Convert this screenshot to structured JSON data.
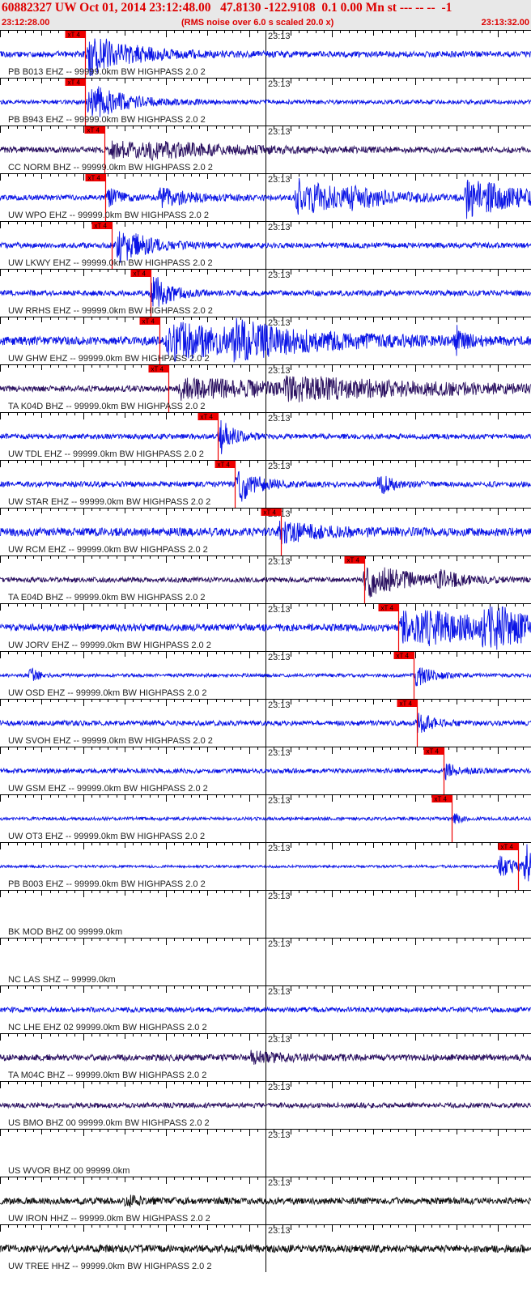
{
  "header": {
    "title": "60882327 UW Oct 01, 2014 23:12:48.00   47.8130 -122.9108  0.1 0.00 Mn st --- -- --  -1",
    "start_time": "23:12:28.00",
    "rms_note": "(RMS noise over 6.0 s scaled 20.0 x)",
    "end_time": "23:13:32.00"
  },
  "colors": {
    "blue": "#0a14e6",
    "dark": "#2a1060",
    "black": "#111111",
    "pick": "#ee0000",
    "axis": "#000000"
  },
  "chart_data": {
    "type": "line",
    "title": "60882327 UW Oct 01, 2014 23:12:48.00   47.8130 -122.9108  0.1 0.00 Mn st --- -- --  -1",
    "x_range": [
      "23:12:28.00",
      "23:13:32.00"
    ],
    "x_tick_label": "23:13",
    "traces": [
      {
        "label": "PB B013 EHZ -- 99999.0km BW  HIGHPASS  2.0  2",
        "color": "blue",
        "noise": 0.14,
        "pick": {
          "label": "xT 4",
          "t": 10.2
        },
        "bursts": [
          {
            "t": 10.5,
            "amp": 1.0,
            "dur": 5
          }
        ]
      },
      {
        "label": "PB B943 EHZ -- 99999.0km BW  HIGHPASS  2.0  2",
        "color": "blue",
        "noise": 0.1,
        "pick": {
          "label": "xT 4",
          "t": 10.2
        },
        "bursts": [
          {
            "t": 10.5,
            "amp": 0.95,
            "dur": 4
          }
        ]
      },
      {
        "label": "CC NORM BHZ -- 99999.0km BW  HIGHPASS  2.0  2",
        "color": "dark",
        "noise": 0.14,
        "pick": {
          "label": "xT 4",
          "t": 12.6
        },
        "bursts": [
          {
            "t": 13.2,
            "amp": 0.35,
            "dur": 8
          },
          {
            "t": 18,
            "amp": 0.2,
            "dur": 10
          }
        ]
      },
      {
        "label": "UW WPO EHZ -- 99999.0km BW  HIGHPASS  2.0  2",
        "color": "blue",
        "noise": 0.12,
        "pick": {
          "label": "xT 4",
          "t": 12.7
        },
        "bursts": [
          {
            "t": 12.8,
            "amp": 0.5,
            "dur": 1.5
          },
          {
            "t": 19,
            "amp": 0.45,
            "dur": 4
          },
          {
            "t": 35.5,
            "amp": 0.9,
            "dur": 7
          },
          {
            "t": 42,
            "amp": 0.3,
            "dur": 3
          },
          {
            "t": 56,
            "amp": 1.0,
            "dur": 6
          }
        ]
      },
      {
        "label": "UW LKWY EHZ -- 99999.0km BW  HIGHPASS  2.0  2",
        "color": "blue",
        "noise": 0.13,
        "pick": {
          "label": "xT 4",
          "t": 13.5
        },
        "bursts": [
          {
            "t": 14,
            "amp": 1.0,
            "dur": 3
          }
        ]
      },
      {
        "label": "UW RRHS EHZ -- 99999.0km BW  HIGHPASS  2.0  2",
        "color": "blue",
        "noise": 0.13,
        "pick": {
          "label": "xT 4",
          "t": 18.1
        },
        "bursts": [
          {
            "t": 18.2,
            "amp": 1.0,
            "dur": 2
          }
        ]
      },
      {
        "label": "UW GHW EHZ -- 99999.0km BW  HIGHPASS  2.0  2",
        "color": "blue",
        "noise": 0.2,
        "pick": {
          "label": "xT 4",
          "t": 19.2
        },
        "bursts": [
          {
            "t": 20,
            "amp": 0.85,
            "dur": 12
          },
          {
            "t": 28,
            "amp": 0.5,
            "dur": 8
          },
          {
            "t": 54.8,
            "amp": 0.6,
            "dur": 1
          },
          {
            "t": 65.5,
            "amp": 0.9,
            "dur": 1
          }
        ]
      },
      {
        "label": "TA K04D BHZ -- 99999.0km BW  HIGHPASS  2.0  2",
        "color": "dark",
        "noise": 0.14,
        "pick": {
          "label": "xT 4",
          "t": 20.3
        },
        "bursts": [
          {
            "t": 21.5,
            "amp": 0.45,
            "dur": 18
          },
          {
            "t": 34,
            "amp": 0.35,
            "dur": 20
          }
        ]
      },
      {
        "label": "UW TDL EHZ -- 99999.0km BW  HIGHPASS  2.0  2",
        "color": "blue",
        "noise": 0.12,
        "pick": {
          "label": "xT 4",
          "t": 26.2
        },
        "bursts": [
          {
            "t": 26.3,
            "amp": 1.0,
            "dur": 1.5
          }
        ]
      },
      {
        "label": "UW STAR EHZ -- 99999.0km BW  HIGHPASS  2.0  2",
        "color": "blue",
        "noise": 0.13,
        "pick": {
          "label": "xT 4",
          "t": 28.3
        },
        "bursts": [
          {
            "t": 28.5,
            "amp": 1.0,
            "dur": 2
          },
          {
            "t": 45.5,
            "amp": 0.55,
            "dur": 1.5
          }
        ]
      },
      {
        "label": "UW RCM EHZ -- 99999.0km BW  HIGHPASS  2.0  2",
        "color": "blue",
        "noise": 0.2,
        "pick": {
          "label": "xT 4",
          "t": 33.9
        },
        "bursts": [
          {
            "t": 33.5,
            "amp": 0.45,
            "dur": 5
          }
        ]
      },
      {
        "label": "TA E04D BHZ -- 99999.0km BW  HIGHPASS  2.0  2",
        "color": "dark",
        "noise": 0.12,
        "pick": {
          "label": "xT 4",
          "t": 43.9
        },
        "bursts": [
          {
            "t": 43.8,
            "amp": 0.85,
            "dur": 5
          },
          {
            "t": 52.5,
            "amp": 0.4,
            "dur": 2
          }
        ]
      },
      {
        "label": "UW JORV EHZ -- 99999.0km BW  HIGHPASS  2.0  2",
        "color": "blue",
        "noise": 0.17,
        "pick": {
          "label": "xT 4",
          "t": 48.0
        },
        "bursts": [
          {
            "t": 48.2,
            "amp": 1.0,
            "dur": 12
          },
          {
            "t": 58,
            "amp": 0.8,
            "dur": 5
          }
        ]
      },
      {
        "label": "UW OSD EHZ -- 99999.0km BW  HIGHPASS  2.0  2",
        "color": "blue",
        "noise": 0.08,
        "pick": {
          "label": "xT 4",
          "t": 49.9
        },
        "bursts": [
          {
            "t": 3.5,
            "amp": 0.4,
            "dur": 1
          },
          {
            "t": 49.9,
            "amp": 0.6,
            "dur": 2
          }
        ]
      },
      {
        "label": "UW SVOH EHZ -- 99999.0km BW  HIGHPASS  2.0  2",
        "color": "blue",
        "noise": 0.12,
        "pick": {
          "label": "xT 4",
          "t": 50.2
        },
        "bursts": [
          {
            "t": 50.2,
            "amp": 0.7,
            "dur": 1.5
          }
        ]
      },
      {
        "label": "UW GSM EHZ -- 99999.0km BW  HIGHPASS  2.0  2",
        "color": "blue",
        "noise": 0.11,
        "pick": {
          "label": "xT 4",
          "t": 53.5
        },
        "bursts": [
          {
            "t": 53.5,
            "amp": 0.4,
            "dur": 1.5
          }
        ]
      },
      {
        "label": "UW OT3 EHZ -- 99999.0km BW  HIGHPASS  2.0  2",
        "color": "blue",
        "noise": 0.08,
        "pick": {
          "label": "xT 4",
          "t": 54.4
        },
        "bursts": [
          {
            "t": 54.5,
            "amp": 0.3,
            "dur": 1
          }
        ]
      },
      {
        "label": "PB B003 EHZ -- 99999.0km BW  HIGHPASS  2.0  2",
        "color": "blue",
        "noise": 0.06,
        "pick": {
          "label": "xT 4",
          "t": 62.4
        },
        "bursts": [
          {
            "t": 60,
            "amp": 0.5,
            "dur": 3
          },
          {
            "t": 63.2,
            "amp": 1.0,
            "dur": 3
          }
        ]
      },
      {
        "label": "BK MOD BHZ 00 99999.0km",
        "color": "blue",
        "noise": 0,
        "pick": null,
        "bursts": []
      },
      {
        "label": "NC LAS SHZ -- 99999.0km",
        "color": "blue",
        "noise": 0,
        "pick": null,
        "bursts": []
      },
      {
        "label": "NC LHE EHZ 02 99999.0km BW  HIGHPASS  2.0  2",
        "color": "blue",
        "noise": 0.12,
        "pick": null,
        "bursts": []
      },
      {
        "label": "TA M04C BHZ -- 99999.0km BW  HIGHPASS  2.0  2",
        "color": "dark",
        "noise": 0.15,
        "pick": null,
        "bursts": [
          {
            "t": 30,
            "amp": 0.25,
            "dur": 4
          }
        ]
      },
      {
        "label": "US BMO BHZ 00 99999.0km BW  HIGHPASS  2.0  2",
        "color": "dark",
        "noise": 0.12,
        "pick": null,
        "bursts": []
      },
      {
        "label": "US WVOR BHZ 00 99999.0km",
        "color": "blue",
        "noise": 0,
        "pick": null,
        "bursts": []
      },
      {
        "label": "UW IRON HHZ -- 99999.0km BW  HIGHPASS  2.0  2",
        "color": "black",
        "noise": 0.16,
        "pick": null,
        "bursts": [
          {
            "t": 15,
            "amp": 0.25,
            "dur": 1.5
          }
        ]
      },
      {
        "label": "UW TREE HHZ -- 99999.0km BW  HIGHPASS  2.0  2",
        "color": "black",
        "noise": 0.18,
        "pick": null,
        "bursts": []
      }
    ]
  }
}
